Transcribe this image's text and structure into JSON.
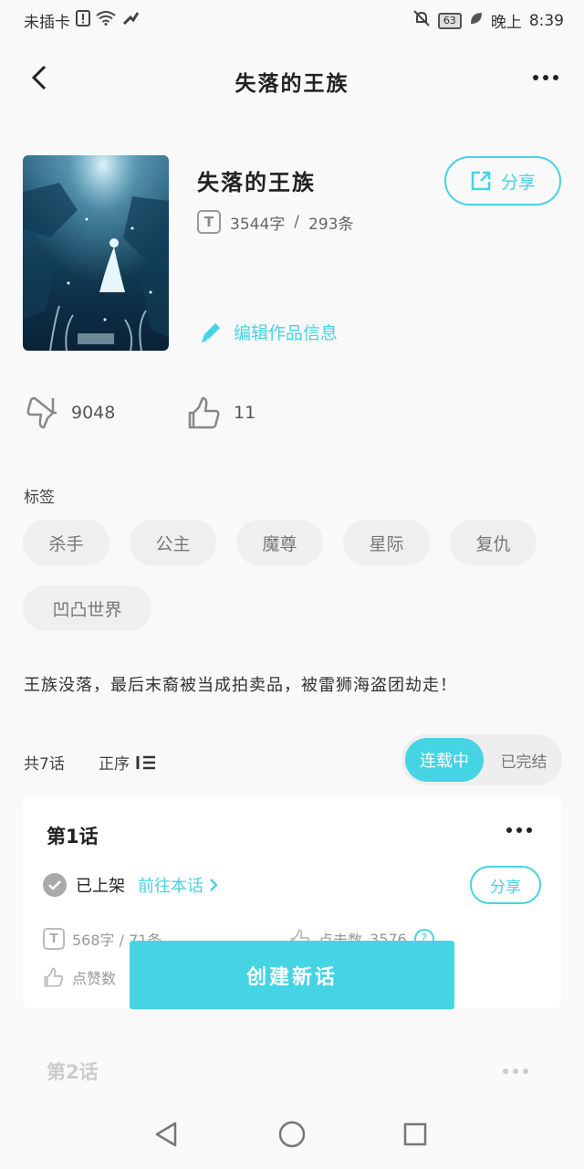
{
  "status_bar": {
    "carrier": "未插卡",
    "battery": "63",
    "period": "晚上",
    "time": "8:39"
  },
  "header": {
    "title": "失落的王族"
  },
  "work": {
    "title": "失落的王族",
    "share_label": "分享",
    "word_count": "3544字",
    "separator": "/",
    "item_count": "293条",
    "edit_label": "编辑作品信息"
  },
  "likes": {
    "count_1": "9048",
    "count_2": "11"
  },
  "tags": {
    "label": "标签",
    "items": [
      "杀手",
      "公主",
      "魔尊",
      "星际",
      "复仇",
      "凹凸世界"
    ]
  },
  "summary": "王族没落，最后末裔被当成拍卖品，被雷狮海盗团劫走！",
  "chapters": {
    "count": "共7话",
    "order_label": "正序",
    "tab_ongoing": "连载中",
    "tab_finished": "已完结"
  },
  "card1": {
    "title": "第1话",
    "status": "已上架",
    "goto_label": "前往本话",
    "share_label": "分享",
    "word_count": "568字 / 71条",
    "click_label": "点击数",
    "click_count": "3576",
    "help": "?",
    "like_label": "点赞数"
  },
  "create_button": "创建新话",
  "card2": {
    "title": "第2话"
  },
  "colors": {
    "accent": "#45d4e3"
  }
}
